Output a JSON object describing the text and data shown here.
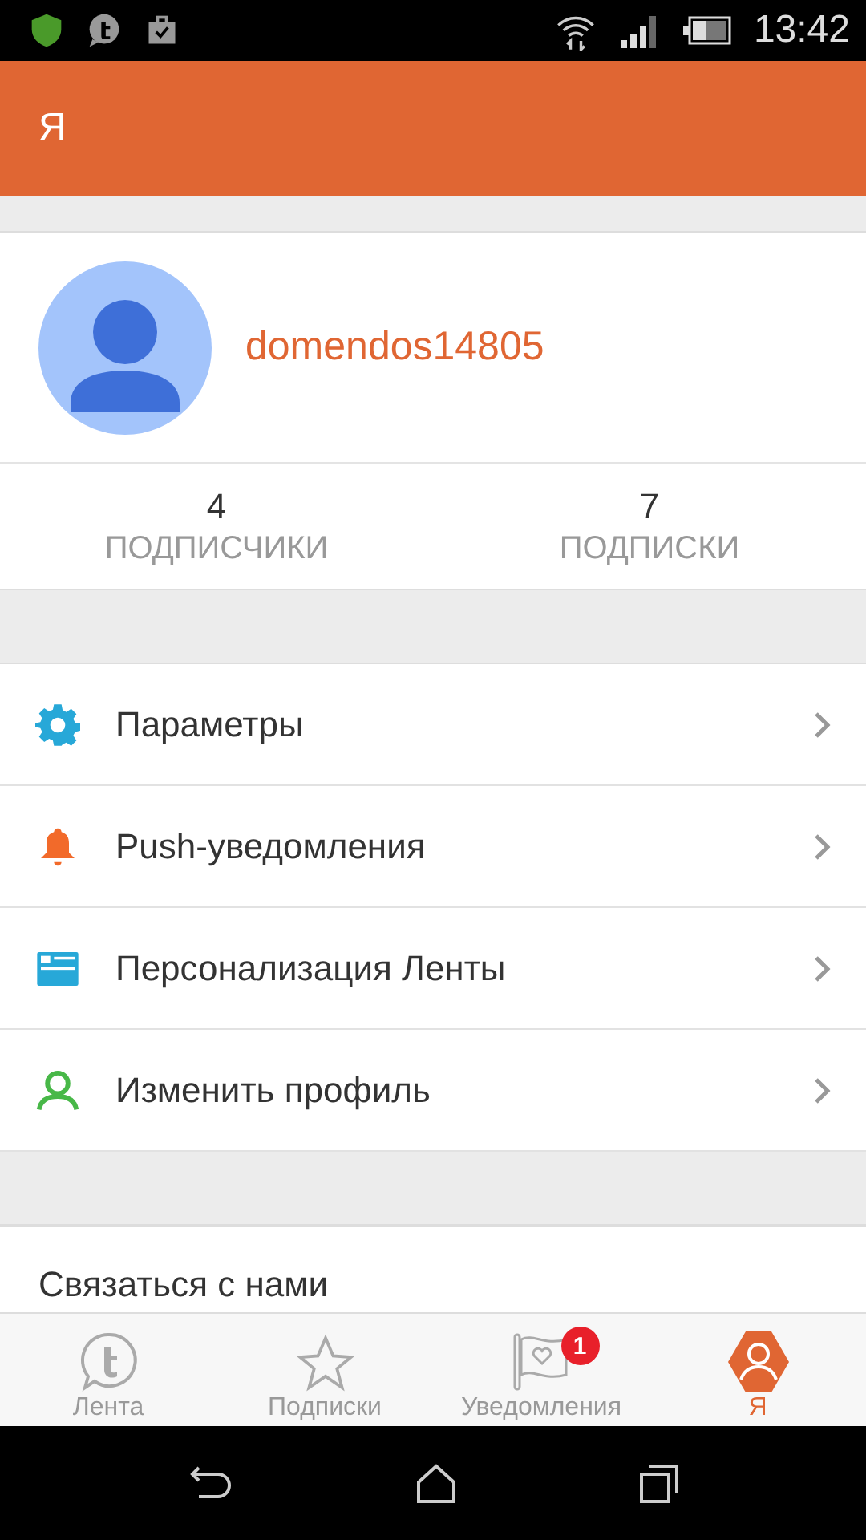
{
  "status_bar": {
    "time": "13:42"
  },
  "app_bar": {
    "title": "Я"
  },
  "profile": {
    "username": "domendos14805"
  },
  "stats": [
    {
      "count": "4",
      "label": "ПОДПИСЧИКИ"
    },
    {
      "count": "7",
      "label": "ПОДПИСКИ"
    }
  ],
  "menu": [
    {
      "kind": "gear",
      "label": "Параметры"
    },
    {
      "kind": "bell",
      "label": "Push-уведомления"
    },
    {
      "kind": "card",
      "label": "Персонализация Ленты"
    },
    {
      "kind": "person",
      "label": "Изменить профиль"
    }
  ],
  "contact": {
    "label": "Связаться с нами"
  },
  "tabs": [
    {
      "kind": "feed",
      "label": "Лента",
      "selected": false
    },
    {
      "kind": "star",
      "label": "Подписки",
      "selected": false
    },
    {
      "kind": "flag",
      "label": "Уведомления",
      "selected": false,
      "badge": "1"
    },
    {
      "kind": "me",
      "label": "Я",
      "selected": true
    }
  ]
}
